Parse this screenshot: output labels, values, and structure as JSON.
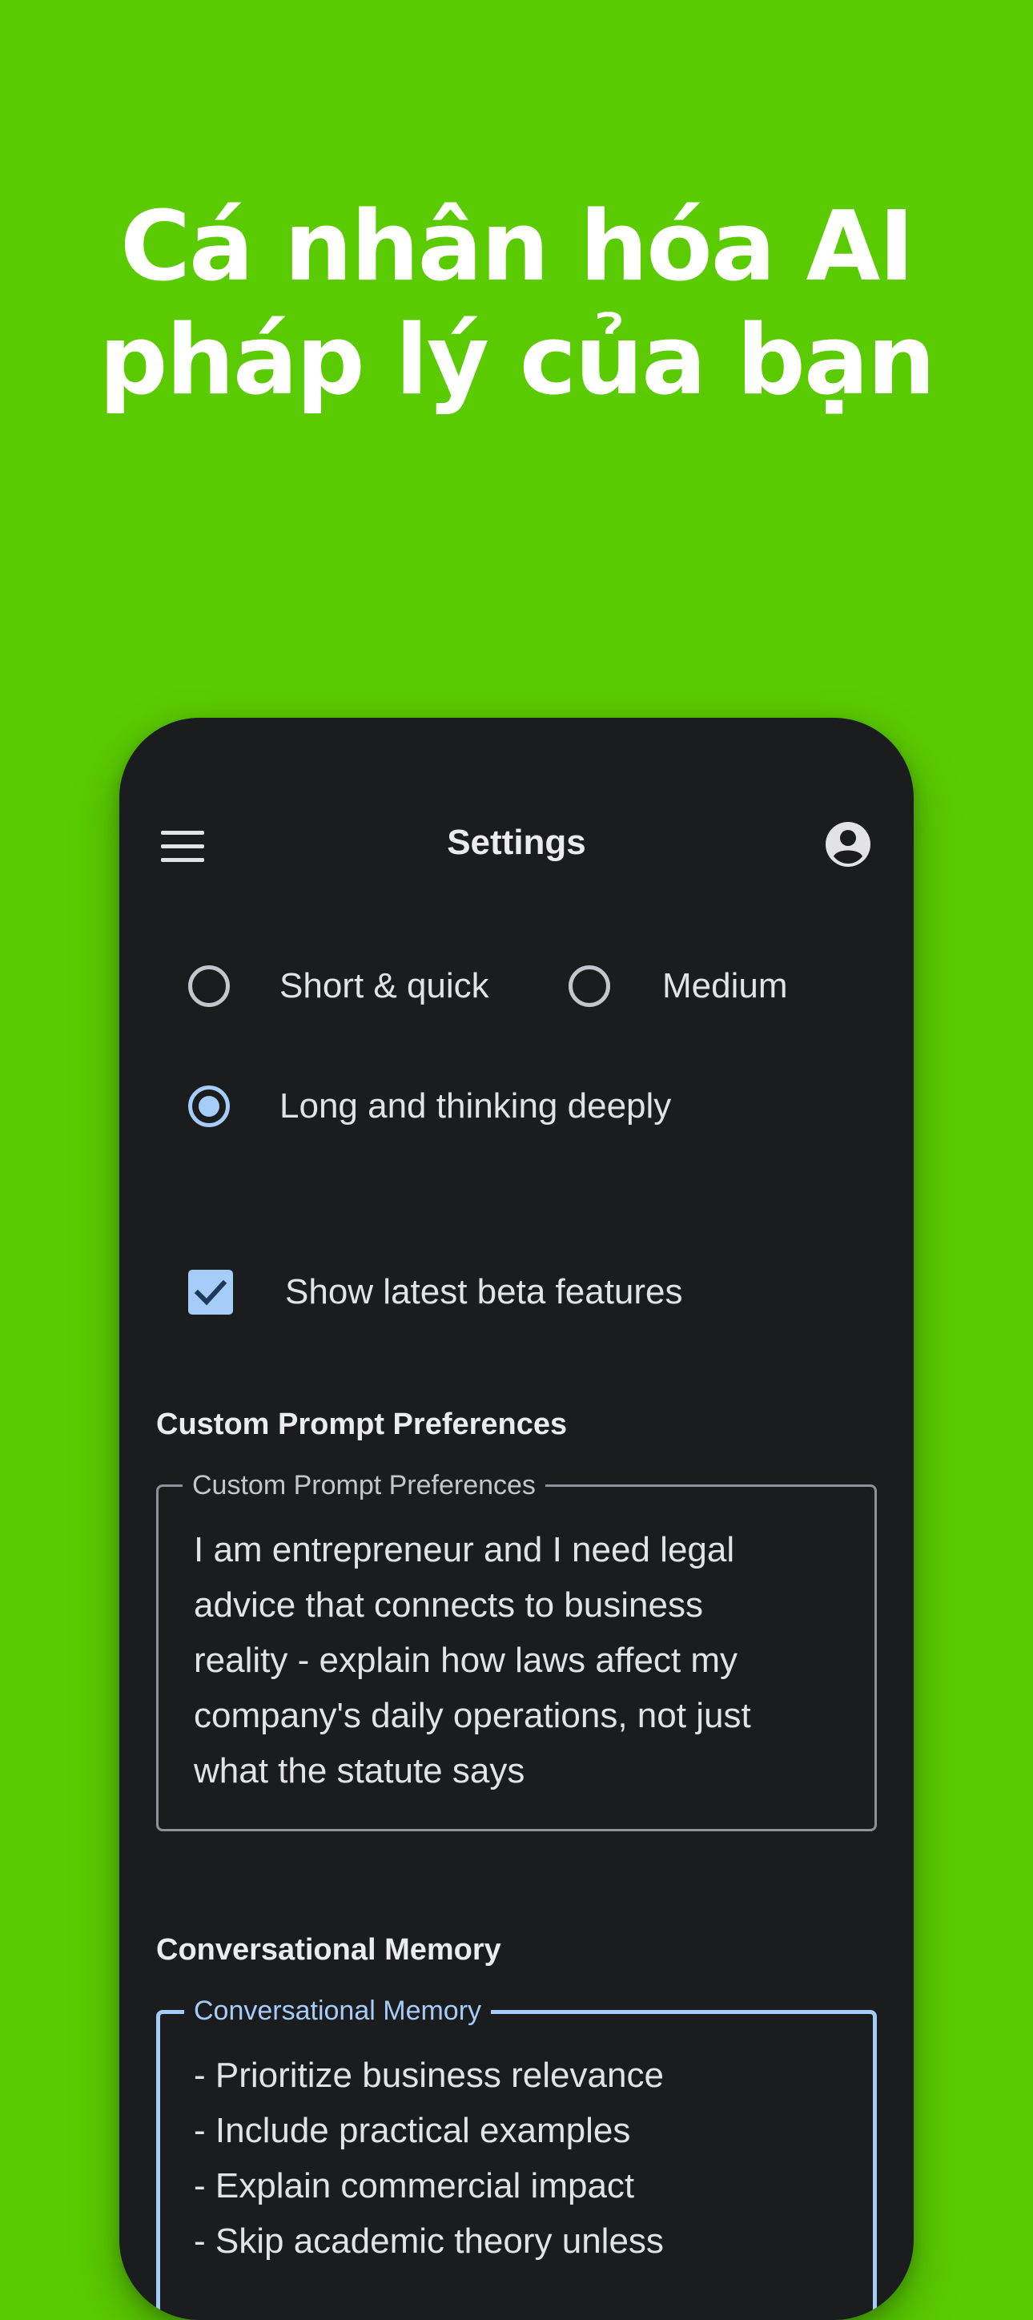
{
  "headline": {
    "line1": "Cá nhân hóa AI",
    "line2": "pháp lý của bạn"
  },
  "app_bar": {
    "title": "Settings",
    "menu_icon": "menu-icon",
    "account_icon": "account-circle-icon"
  },
  "response_length": {
    "options": [
      {
        "label": "Short & quick",
        "selected": false
      },
      {
        "label": "Medium",
        "selected": false
      },
      {
        "label": "Long and thinking deeply",
        "selected": true
      }
    ]
  },
  "beta": {
    "label": "Show latest beta features",
    "checked": true
  },
  "custom_prompt": {
    "section_title": "Custom Prompt Preferences",
    "field_label": "Custom Prompt Preferences",
    "value": "I am entrepreneur and I  need legal\nadvice that connects to business\nreality - explain how laws affect my\ncompany's daily operations, not just\nwhat the statute says"
  },
  "memory": {
    "section_title": "Conversational Memory",
    "field_label": "Conversational Memory",
    "value": "- Prioritize business relevance\n- Include practical examples\n- Explain commercial impact\n- Skip academic theory unless"
  },
  "colors": {
    "background": "#5acb00",
    "phone": "#1b1c1e",
    "accent": "#a6cdfa"
  }
}
